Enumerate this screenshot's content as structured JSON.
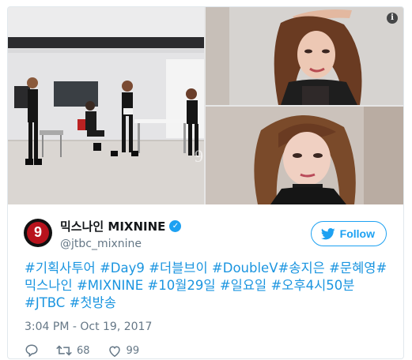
{
  "tweet": {
    "display_name": "믹스나인 MIXNINE",
    "handle": "@jtbc_mixnine",
    "avatar_text": "9",
    "follow_label": "Follow",
    "text": "#기획사투어 #Day9 #더블브이 #DoubleV#송지은 #문혜영#믹스나인 #MIXNINE #10월29일 #일요일 #오후4시50분 #JTBC #첫방송",
    "timestamp": "3:04 PM - Oct 19, 2017",
    "retweets": "68",
    "likes": "99"
  },
  "media": {
    "images": [
      "dance-practice-photo",
      "portrait-arm-raised-photo",
      "portrait-closeup-photo"
    ],
    "info_icon": "i"
  },
  "colors": {
    "accent": "#1da1f2",
    "link": "#1b95e0",
    "muted": "#657786",
    "avatar_red": "#b8131d"
  },
  "icons": [
    "info-icon",
    "verified-badge-icon",
    "twitter-bird-icon",
    "reply-icon",
    "retweet-icon",
    "like-icon"
  ]
}
